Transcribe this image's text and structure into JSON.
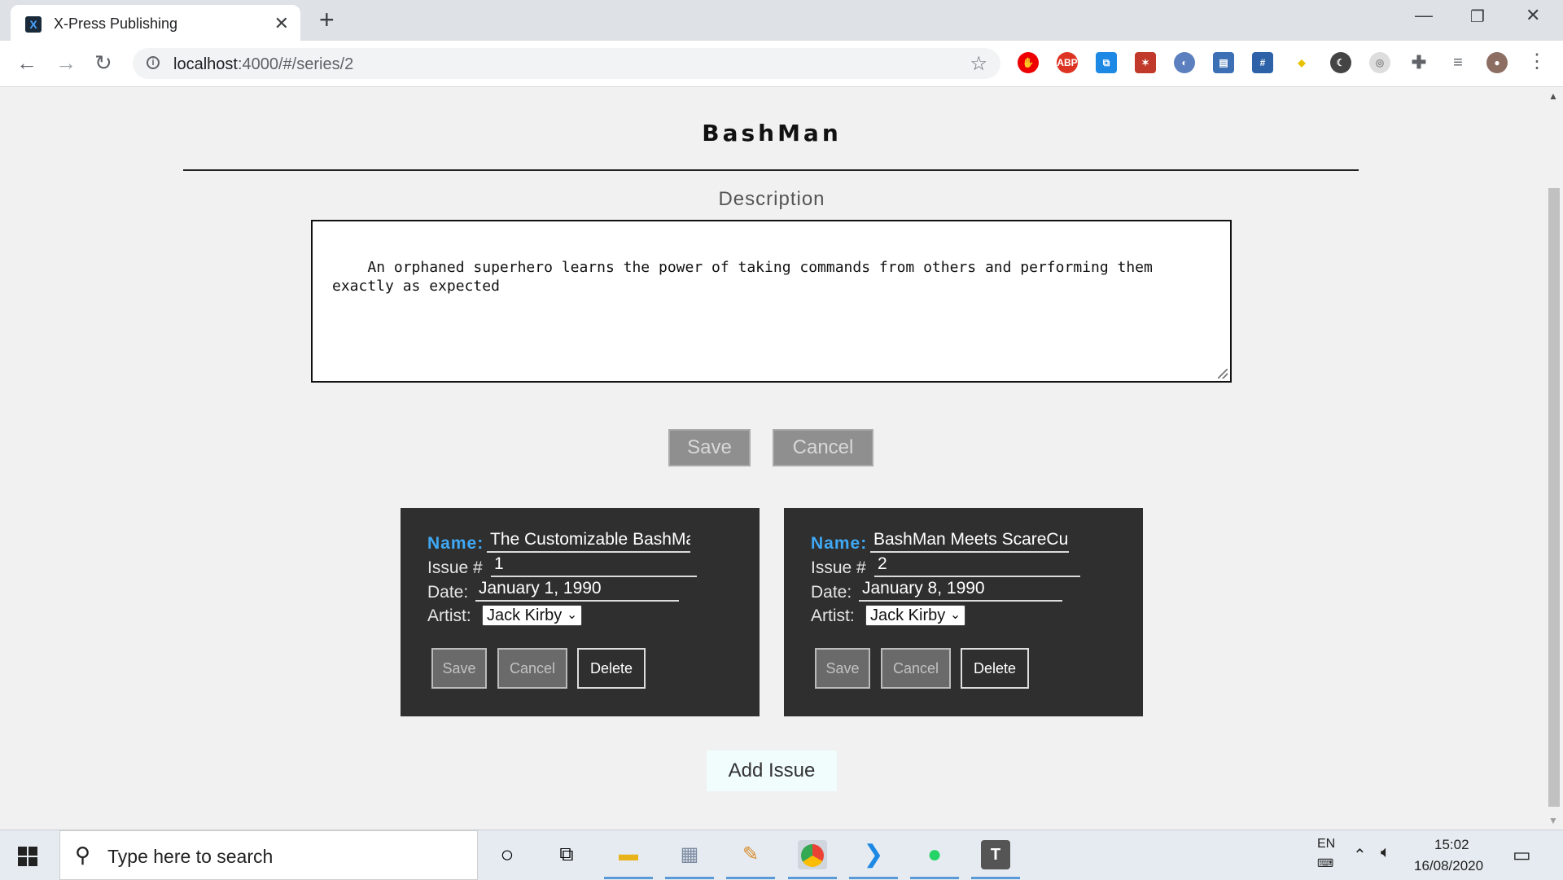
{
  "browser": {
    "tab_title": "X-Press Publishing",
    "tab_favicon_letter": "X",
    "url_host": "localhost",
    "url_path": ":4000/#/series/2",
    "icons": [
      "back-icon",
      "forward-icon",
      "reload-icon",
      "info-icon",
      "star-icon",
      "extensions-icon",
      "menu-icon"
    ]
  },
  "series": {
    "title": "BashMan",
    "description_label": "Description",
    "description": "An orphaned superhero learns the power of taking commands from others and performing them exactly as expected",
    "save_label": "Save",
    "cancel_label": "Cancel"
  },
  "issue_labels": {
    "name": "Name:",
    "issue": "Issue #",
    "date": "Date:",
    "artist": "Artist:",
    "save": "Save",
    "cancel": "Cancel",
    "delete": "Delete"
  },
  "issues": [
    {
      "name": "The Customizable BashMan",
      "issue_number": "1",
      "date": "January 1, 1990",
      "artist": "Jack Kirby"
    },
    {
      "name": "BashMan Meets ScareCurl",
      "issue_number": "2",
      "date": "January 8, 1990",
      "artist": "Jack Kirby"
    }
  ],
  "add_issue_label": "Add Issue",
  "taskbar": {
    "search_placeholder": "Type here to search",
    "language": "EN",
    "time": "15:02",
    "date": "16/08/2020"
  },
  "colors": {
    "accent_name_label": "#3fa9f5",
    "card_background": "#2f2f2f",
    "page_background": "#f1f1f1"
  }
}
